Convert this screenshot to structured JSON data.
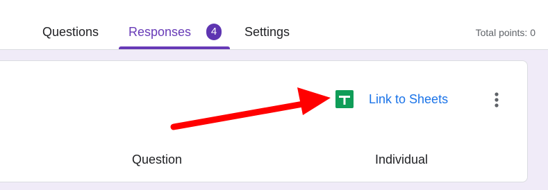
{
  "tabs": {
    "questions": "Questions",
    "responses": "Responses",
    "responses_count": "4",
    "settings": "Settings"
  },
  "total_points": "Total points: 0",
  "card": {
    "link_label": "Link to Sheets",
    "icons": {
      "sheets": "sheets-icon",
      "more": "more-vert-icon",
      "arrow": "red-arrow-annotation"
    },
    "subtabs": {
      "question": "Question",
      "individual": "Individual"
    }
  },
  "colors": {
    "accent": "#673ab7",
    "badge": "#5e35b1",
    "link": "#1a73e8",
    "sheets_green": "#0f9d58",
    "arrow_red": "#ff0000",
    "background": "#f0ebf8"
  }
}
